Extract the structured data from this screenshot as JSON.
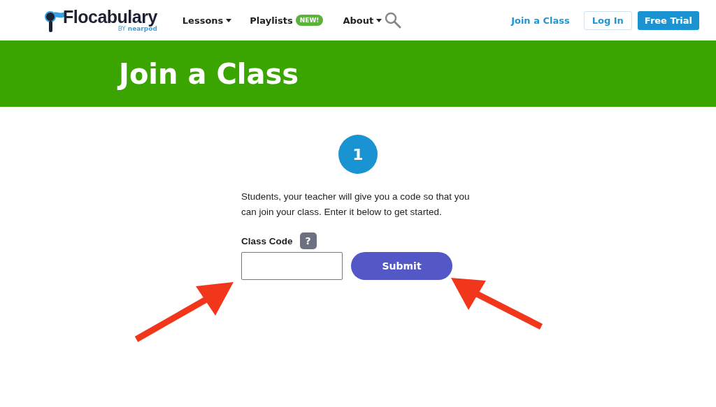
{
  "header": {
    "logo": {
      "name": "Flocabulary",
      "byline_prefix": "BY",
      "byline": "nearpod"
    },
    "nav": [
      {
        "label": "Lessons",
        "kind": "dropdown"
      },
      {
        "label": "Playlists",
        "kind": "badge",
        "badge": "NEW!"
      },
      {
        "label": "About",
        "kind": "dropdown"
      }
    ],
    "actions": [
      {
        "label": "Join a Class",
        "kind": "link"
      },
      {
        "label": "Log In",
        "kind": "outline"
      },
      {
        "label": "Free Trial",
        "kind": "solid"
      }
    ]
  },
  "banner": {
    "title": "Join a Class"
  },
  "step": "1",
  "instructions": "Students, your teacher will give you a code so that you can join your class. Enter it below to get started.",
  "form": {
    "label": "Class Code",
    "help": "?",
    "submit": "Submit"
  }
}
